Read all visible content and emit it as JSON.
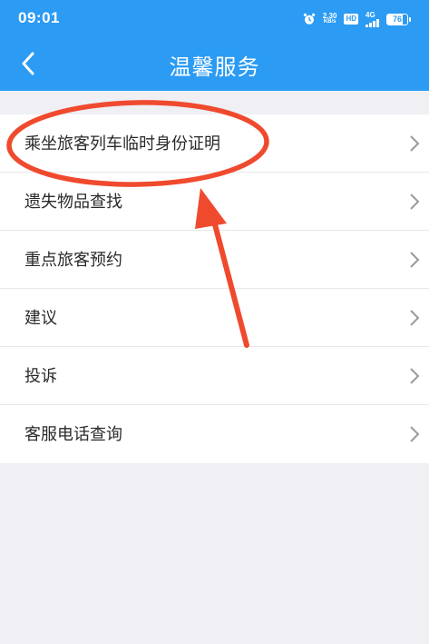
{
  "status_bar": {
    "time": "09:01",
    "net_speed": "2.30",
    "net_speed_unit": "KB/s",
    "hd_label": "HD",
    "network_type": "4G",
    "battery_level": "76"
  },
  "nav": {
    "title": "温馨服务"
  },
  "menu": {
    "items": [
      {
        "label": "乘坐旅客列车临时身份证明"
      },
      {
        "label": "遗失物品查找"
      },
      {
        "label": "重点旅客预约"
      },
      {
        "label": "建议"
      },
      {
        "label": "投诉"
      },
      {
        "label": "客服电话查询"
      }
    ]
  },
  "colors": {
    "header": "#2b9bf4",
    "background": "#efeff4",
    "annotation": "#f04a2e"
  }
}
